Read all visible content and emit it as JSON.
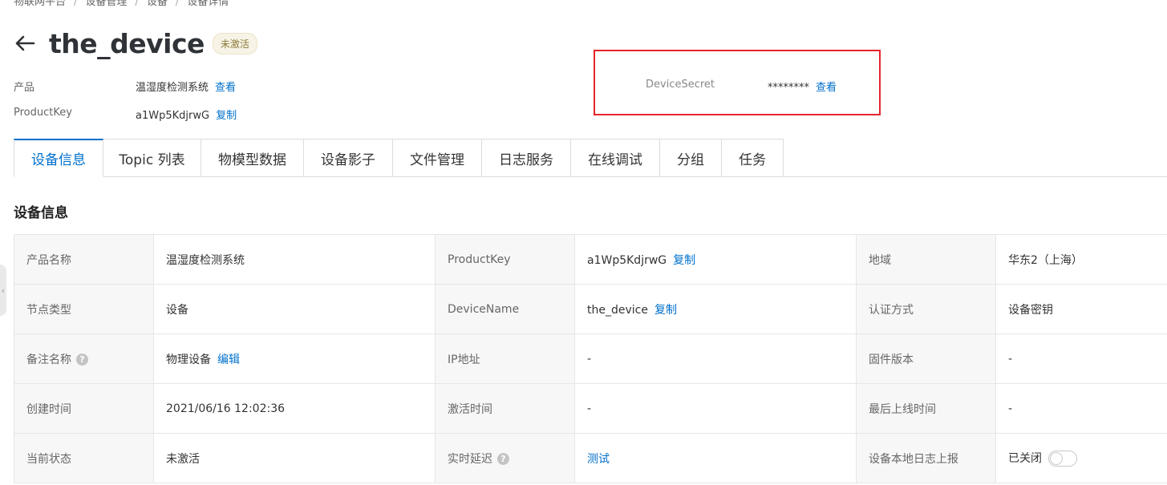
{
  "breadcrumb": [
    "物联网平台",
    "设备管理",
    "设备",
    "设备详情"
  ],
  "header": {
    "title": "the_device",
    "status": "未激活"
  },
  "meta": {
    "product_label": "产品",
    "product_value": "温湿度检测系统",
    "product_link": "查看",
    "productkey_label": "ProductKey",
    "productkey_value": "a1Wp5KdjrwG",
    "productkey_link": "复制",
    "secret_label": "DeviceSecret",
    "secret_value": "********",
    "secret_link": "查看"
  },
  "tabs": [
    "设备信息",
    "Topic 列表",
    "物模型数据",
    "设备影子",
    "文件管理",
    "日志服务",
    "在线调试",
    "分组",
    "任务"
  ],
  "section_title": "设备信息",
  "info": {
    "r1": {
      "k1": "产品名称",
      "v1": "温湿度检测系统",
      "k2": "ProductKey",
      "v2": "a1Wp5KdjrwG",
      "v2_link": "复制",
      "k3": "地域",
      "v3": "华东2（上海）"
    },
    "r2": {
      "k1": "节点类型",
      "v1": "设备",
      "k2": "DeviceName",
      "v2": "the_device",
      "v2_link": "复制",
      "k3": "认证方式",
      "v3": "设备密钥"
    },
    "r3": {
      "k1": "备注名称",
      "v1": "物理设备",
      "v1_link": "编辑",
      "k2": "IP地址",
      "v2": "-",
      "k3": "固件版本",
      "v3": "-"
    },
    "r4": {
      "k1": "创建时间",
      "v1": "2021/06/16 12:02:36",
      "k2": "激活时间",
      "v2": "-",
      "k3": "最后上线时间",
      "v3": "-"
    },
    "r5": {
      "k1": "当前状态",
      "v1": "未激活",
      "k2": "实时延迟",
      "v2_link": "测试",
      "k3": "设备本地日志上报",
      "v3": "已关闭"
    }
  },
  "colors": {
    "accent": "#0070cc",
    "highlight": "#e6242b"
  },
  "icons": {
    "back": "arrow-left-icon",
    "help": "question-circle-icon"
  }
}
